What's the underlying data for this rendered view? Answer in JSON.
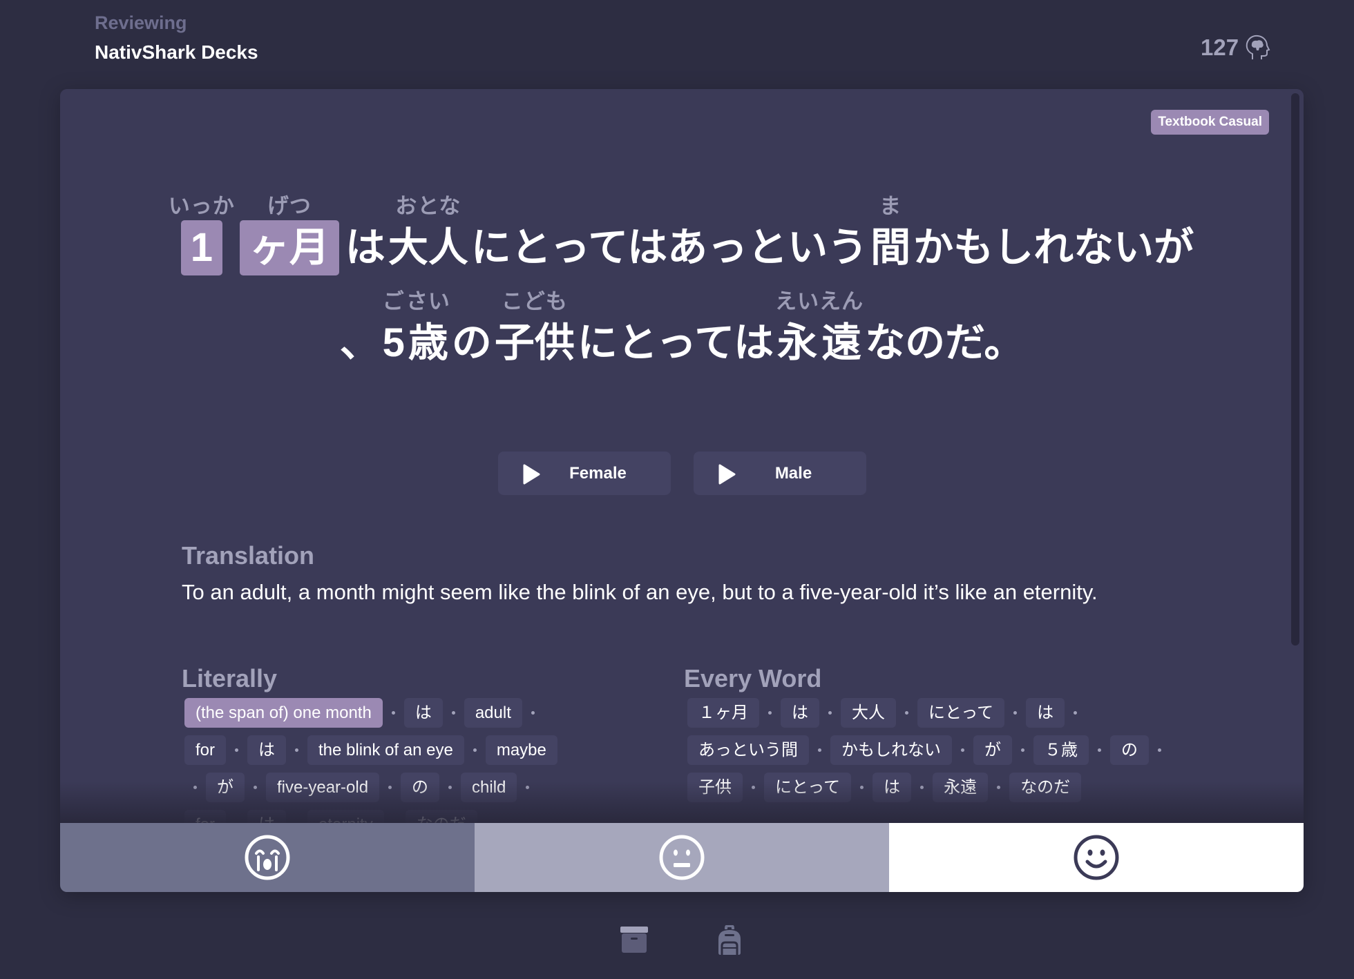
{
  "header": {
    "subtitle": "Reviewing",
    "title": "NativShark Decks",
    "known_count": "127",
    "known_icon": "brain-head-icon"
  },
  "card": {
    "badge": "Textbook Casual",
    "sentence": {
      "lines": [
        [
          {
            "text": "1",
            "ruby": "いっか",
            "highlighted": true
          },
          {
            "text": "ヶ月",
            "ruby": "げつ",
            "highlighted": true
          },
          {
            "text": "は",
            "ruby": ""
          },
          {
            "text": "大人",
            "ruby": "おとな"
          },
          {
            "text": "にとってはあっという",
            "ruby": ""
          },
          {
            "text": "間",
            "ruby": "ま"
          },
          {
            "text": "かもしれないが",
            "ruby": ""
          }
        ],
        [
          {
            "text": "、",
            "ruby": ""
          },
          {
            "text": "5",
            "ruby": "ご"
          },
          {
            "text": "歳",
            "ruby": "さい"
          },
          {
            "text": "の",
            "ruby": ""
          },
          {
            "text": "子供",
            "ruby": "こども"
          },
          {
            "text": "にとっては",
            "ruby": ""
          },
          {
            "text": "永",
            "ruby": "えい"
          },
          {
            "text": "遠",
            "ruby": "えん"
          },
          {
            "text": "なのだ。",
            "ruby": ""
          }
        ]
      ]
    },
    "audio": [
      {
        "label": "Female",
        "icon": "play-icon"
      },
      {
        "label": "Male",
        "icon": "play-icon"
      }
    ],
    "translation": {
      "heading": "Translation",
      "text": "To an adult, a month might seem like the blink of an eye, but to a five-year-old it’s like an eternity."
    },
    "literally": {
      "heading": "Literally",
      "chips": [
        {
          "text": "(the span of) one month",
          "active": true
        },
        {
          "text": "は"
        },
        {
          "text": "adult"
        },
        {
          "text": "for"
        },
        {
          "text": "は"
        },
        {
          "text": "the blink of an eye"
        },
        {
          "text": "maybe"
        },
        {
          "text": "が"
        },
        {
          "text": "five-year-old"
        },
        {
          "text": "の"
        },
        {
          "text": "child"
        },
        {
          "text": "for"
        },
        {
          "text": "は"
        },
        {
          "text": "eternity"
        },
        {
          "text": "なのだ"
        }
      ]
    },
    "every_word": {
      "heading": "Every Word",
      "chips": [
        {
          "text": "１ヶ月"
        },
        {
          "text": "は"
        },
        {
          "text": "大人"
        },
        {
          "text": "にとって"
        },
        {
          "text": "は"
        },
        {
          "text": "あっという間"
        },
        {
          "text": "かもしれない"
        },
        {
          "text": "が"
        },
        {
          "text": "５歳"
        },
        {
          "text": "の"
        },
        {
          "text": "子供"
        },
        {
          "text": "にとって"
        },
        {
          "text": "は"
        },
        {
          "text": "永遠"
        },
        {
          "text": "なのだ"
        }
      ]
    },
    "rating": [
      {
        "name": "hard",
        "icon": "crying-face-icon",
        "color": "#6e718c"
      },
      {
        "name": "ok",
        "icon": "neutral-face-icon",
        "color": "#a6a7bc"
      },
      {
        "name": "easy",
        "icon": "smiling-face-icon",
        "color": "#ffffff"
      }
    ]
  },
  "footer": {
    "icons": [
      "archive-box-icon",
      "backpack-icon"
    ]
  },
  "colors": {
    "background": "#2d2d42",
    "card": "#3b3a57",
    "accent": "#9b89b3",
    "chip": "#444363",
    "muted_text": "#a2a2ba"
  }
}
